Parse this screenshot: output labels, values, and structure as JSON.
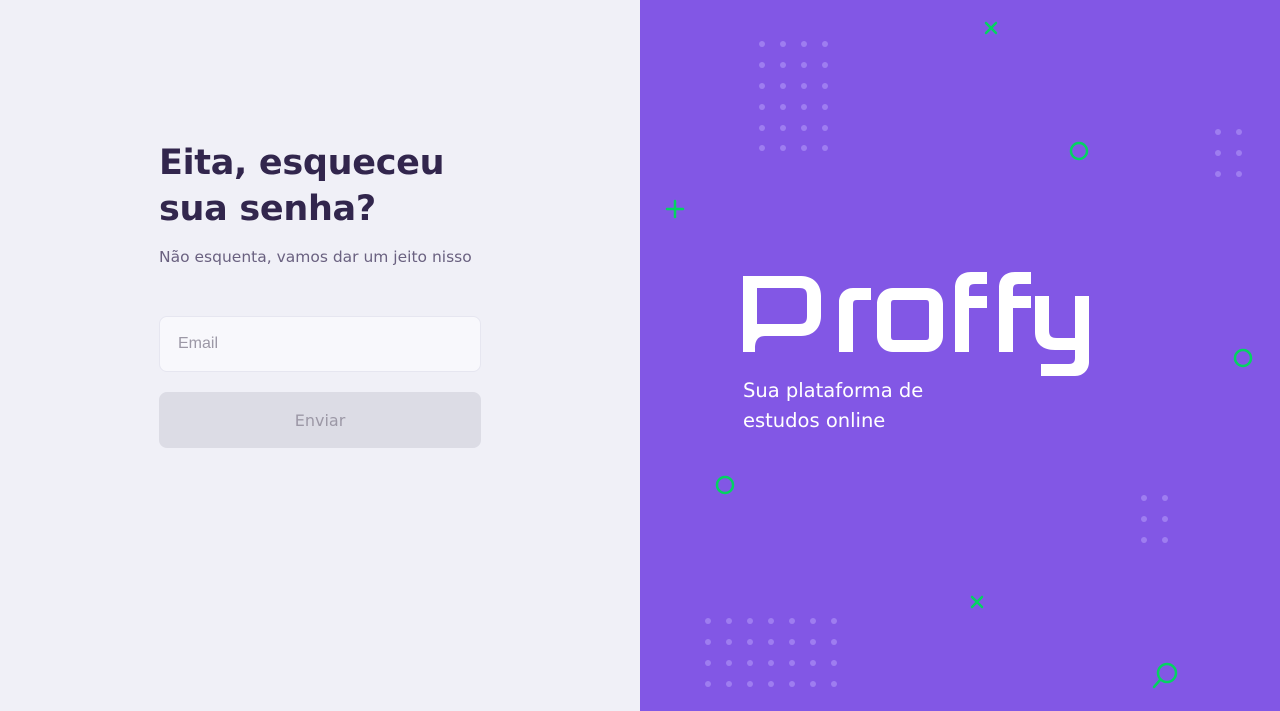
{
  "form": {
    "title": "Eita, esqueceu sua senha?",
    "subtitle": "Não esquenta, vamos dar um jeito nisso",
    "email_placeholder": "Email",
    "email_value": "",
    "submit_label": "Enviar"
  },
  "brand": {
    "name": "Proffy",
    "tagline": "Sua plataforma de estudos online"
  },
  "colors": {
    "background_left": "#F0F0F7",
    "background_right": "#8257E5",
    "title": "#32264D",
    "subtitle": "#6A6180",
    "accent_green": "#04D361",
    "button_disabled": "#DCDCE5",
    "button_text_disabled": "#9C98A6"
  },
  "decorations": [
    {
      "icon": "x-icon"
    },
    {
      "icon": "circle-icon"
    },
    {
      "icon": "plus-icon"
    },
    {
      "icon": "circle-icon"
    },
    {
      "icon": "circle-icon"
    },
    {
      "icon": "x-icon"
    },
    {
      "icon": "magnifier-icon"
    }
  ]
}
